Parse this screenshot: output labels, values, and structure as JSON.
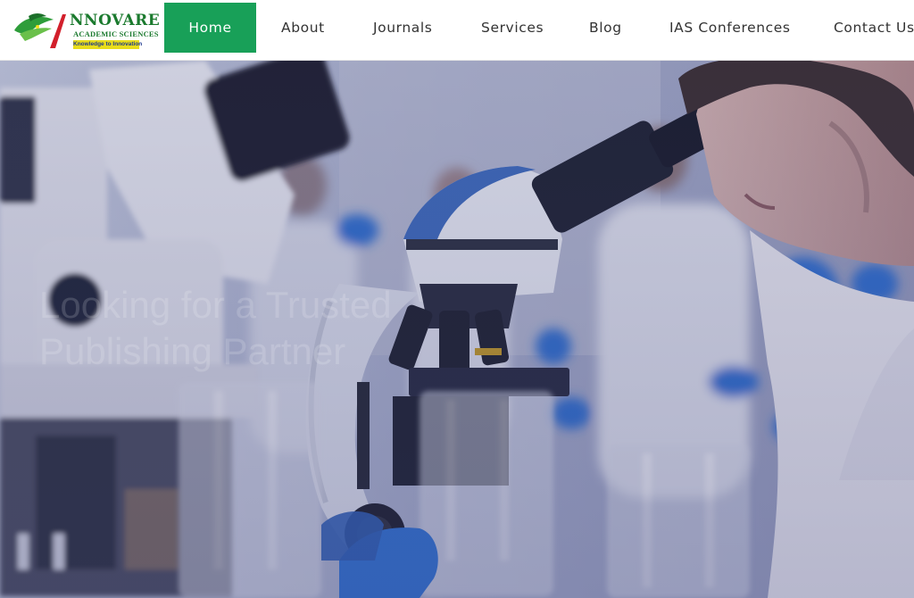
{
  "brand": {
    "name": "NNOVARE",
    "sub": "ACADEMIC SCIENCES",
    "tagline": "Knowledge to Innovation"
  },
  "nav": {
    "items": [
      {
        "label": "Home",
        "active": true
      },
      {
        "label": "About",
        "active": false
      },
      {
        "label": "Journals",
        "active": false
      },
      {
        "label": "Services",
        "active": false
      },
      {
        "label": "Blog",
        "active": false
      },
      {
        "label": "IAS Conferences",
        "active": false
      },
      {
        "label": "Contact Us",
        "active": false
      }
    ]
  },
  "hero": {
    "line1": "Looking for a Trusted",
    "line2": "Publishing Partner"
  },
  "colors": {
    "accent": "#18a058",
    "overlay": "#3b3f7a",
    "logo_green": "#1b7a2e",
    "logo_yellow": "#e9dd1a"
  },
  "icons": {
    "logo": "innovare-leaf-logo"
  }
}
